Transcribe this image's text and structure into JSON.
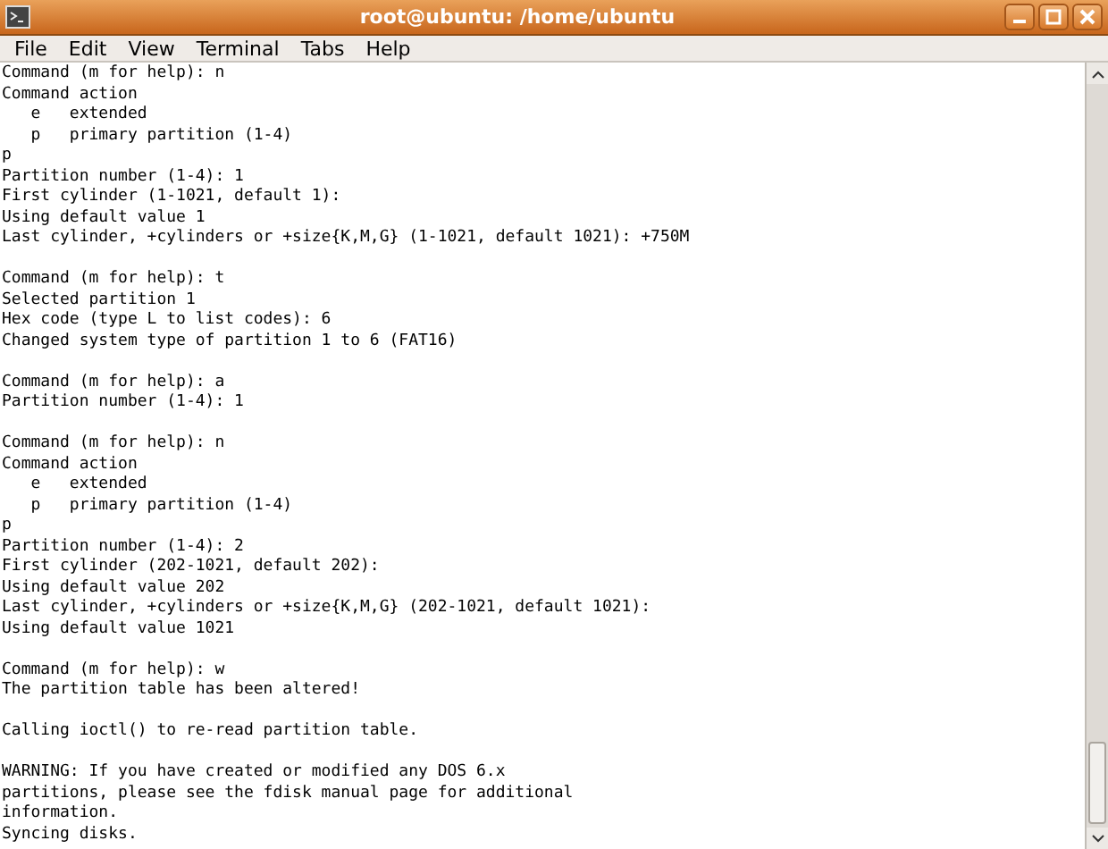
{
  "window": {
    "title": "root@ubuntu: /home/ubuntu"
  },
  "menu": [
    {
      "label": "File"
    },
    {
      "label": "Edit"
    },
    {
      "label": "View"
    },
    {
      "label": "Terminal"
    },
    {
      "label": "Tabs"
    },
    {
      "label": "Help"
    }
  ],
  "terminal": {
    "blocks": [
      [
        "Command (m for help): n",
        "Command action",
        "   e   extended",
        "   p   primary partition (1-4)",
        "p",
        "Partition number (1-4): 1",
        "First cylinder (1-1021, default 1):",
        "Using default value 1",
        "Last cylinder, +cylinders or +size{K,M,G} (1-1021, default 1021): +750M"
      ],
      [
        "Command (m for help): t",
        "Selected partition 1",
        "Hex code (type L to list codes): 6",
        "Changed system type of partition 1 to 6 (FAT16)"
      ],
      [
        "Command (m for help): a",
        "Partition number (1-4): 1"
      ],
      [
        "Command (m for help): n",
        "Command action",
        "   e   extended",
        "   p   primary partition (1-4)",
        "p",
        "Partition number (1-4): 2",
        "First cylinder (202-1021, default 202):",
        "Using default value 202",
        "Last cylinder, +cylinders or +size{K,M,G} (202-1021, default 1021):",
        "Using default value 1021"
      ],
      [
        "Command (m for help): w",
        "The partition table has been altered!"
      ],
      [
        "Calling ioctl() to re-read partition table."
      ],
      [
        "WARNING: If you have created or modified any DOS 6.x",
        "partitions, please see the fdisk manual page for additional",
        "information.",
        "Syncing disks."
      ]
    ]
  }
}
